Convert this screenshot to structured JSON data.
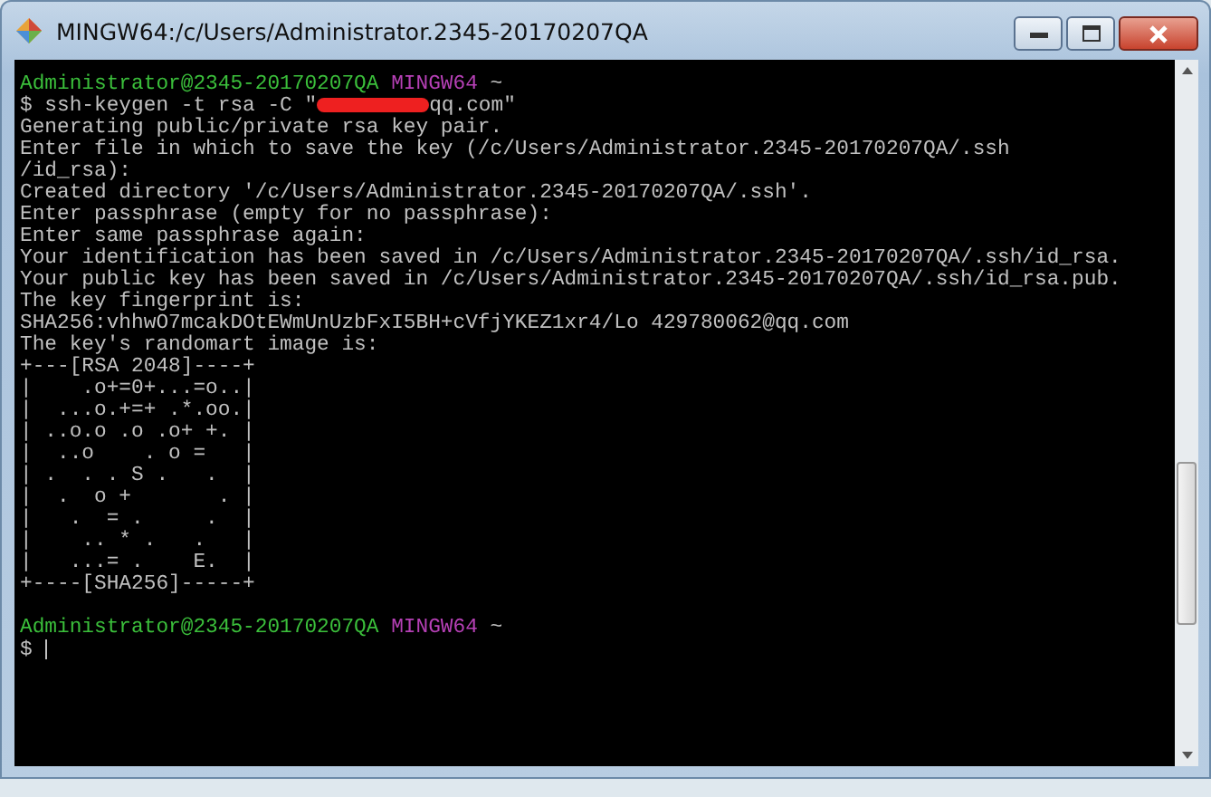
{
  "window": {
    "title": "MINGW64:/c/Users/Administrator.2345-20170207QA"
  },
  "terminal": {
    "lines": [
      {
        "kind": "prompt",
        "user": "Administrator@2345-20170207QA",
        "env": "MINGW64",
        "dir": "~"
      },
      {
        "kind": "command",
        "before": "$ ssh-keygen -t rsa -C \"",
        "redacted": true,
        "after": "qq.com\""
      },
      {
        "kind": "text",
        "text": "Generating public/private rsa key pair."
      },
      {
        "kind": "text",
        "text": "Enter file in which to save the key (/c/Users/Administrator.2345-20170207QA/.ssh"
      },
      {
        "kind": "text",
        "text": "/id_rsa):"
      },
      {
        "kind": "text",
        "text": "Created directory '/c/Users/Administrator.2345-20170207QA/.ssh'."
      },
      {
        "kind": "text",
        "text": "Enter passphrase (empty for no passphrase):"
      },
      {
        "kind": "text",
        "text": "Enter same passphrase again:"
      },
      {
        "kind": "text",
        "text": "Your identification has been saved in /c/Users/Administrator.2345-20170207QA/.ssh/id_rsa."
      },
      {
        "kind": "text",
        "text": "Your public key has been saved in /c/Users/Administrator.2345-20170207QA/.ssh/id_rsa.pub."
      },
      {
        "kind": "text",
        "text": "The key fingerprint is:"
      },
      {
        "kind": "text",
        "text": "SHA256:vhhwO7mcakDOtEWmUnUzbFxI5BH+cVfjYKEZ1xr4/Lo 429780062@qq.com"
      },
      {
        "kind": "text",
        "text": "The key's randomart image is:"
      },
      {
        "kind": "text",
        "text": "+---[RSA 2048]----+"
      },
      {
        "kind": "text",
        "text": "|    .o+=0+...=o..|"
      },
      {
        "kind": "text",
        "text": "|  ...o.+=+ .*.oo.|"
      },
      {
        "kind": "text",
        "text": "| ..o.o .o .o+ +. |"
      },
      {
        "kind": "text",
        "text": "|  ..o    . o =   |"
      },
      {
        "kind": "text",
        "text": "| .  . . S .   .  |"
      },
      {
        "kind": "text",
        "text": "|  .  o +       . |"
      },
      {
        "kind": "text",
        "text": "|   .  = .     .  |"
      },
      {
        "kind": "text",
        "text": "|    .. * .   .   |"
      },
      {
        "kind": "text",
        "text": "|   ...= .    E.  |"
      },
      {
        "kind": "text",
        "text": "+----[SHA256]-----+"
      },
      {
        "kind": "blank"
      },
      {
        "kind": "prompt",
        "user": "Administrator@2345-20170207QA",
        "env": "MINGW64",
        "dir": "~"
      },
      {
        "kind": "input",
        "text": "$ ",
        "cursor": true
      }
    ]
  }
}
